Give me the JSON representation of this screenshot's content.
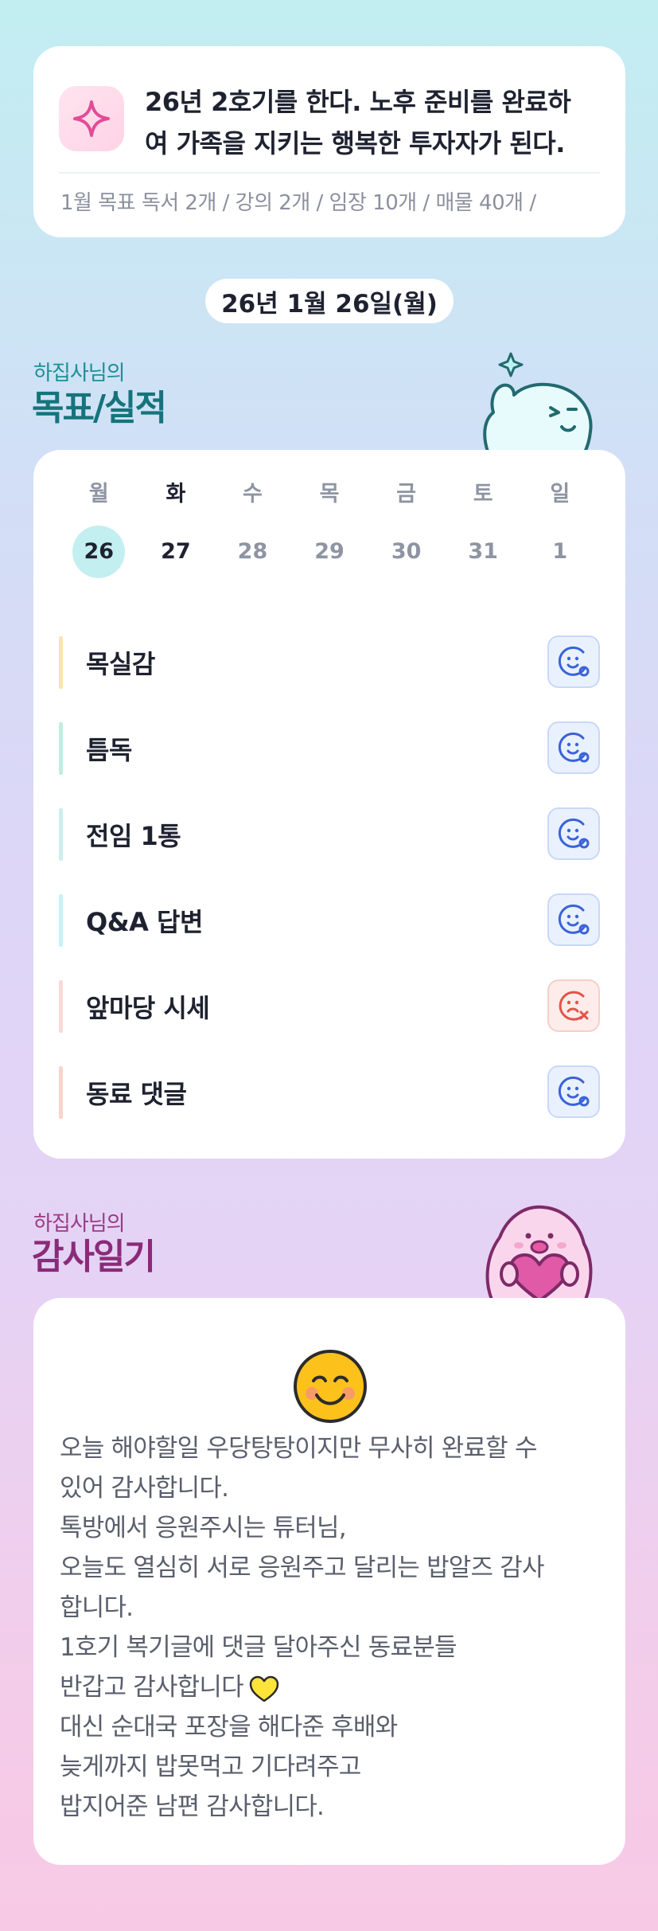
{
  "goal": {
    "icon": "sparkle-icon",
    "line1": "26년 2호기를 한다. 노후 준비를 완료하",
    "line2": "여 가족을 지키는 행복한 투자자가 된다.",
    "monthly": "1월 목표  독서 2개 / 강의 2개 / 임장 10개 / 매물 40개 /"
  },
  "date_label": "26년 1월 26일(월)",
  "record_section": {
    "subtitle": "하집사님의",
    "title": "목표/실적"
  },
  "calendar": {
    "days": [
      "월",
      "화",
      "수",
      "목",
      "금",
      "토",
      "일"
    ],
    "dates": [
      "26",
      "27",
      "28",
      "29",
      "30",
      "31",
      "1"
    ],
    "selected_index": 0
  },
  "tasks": [
    {
      "label": "목실감",
      "status": "done",
      "bar_color": "#fbe3b5"
    },
    {
      "label": "틈독",
      "status": "done",
      "bar_color": "#bfeee0"
    },
    {
      "label": "전임 1통",
      "status": "done",
      "bar_color": "#cdeeee"
    },
    {
      "label": "Q&A 답변",
      "status": "done",
      "bar_color": "#c8f1f5"
    },
    {
      "label": "앞마당 시세",
      "status": "fail",
      "bar_color": "#fddad7"
    },
    {
      "label": "동료 댓글",
      "status": "done",
      "bar_color": "#f9d3cc"
    }
  ],
  "diary_section": {
    "subtitle": "하집사님의",
    "title": "감사일기"
  },
  "diary": {
    "emoji": "smiling-face-icon",
    "lines": [
      "오늘 해야할일 우당탕탕이지만 무사히 완료할 수",
      "있어 감사합니다.",
      "톡방에서 응원주시는 튜터님,",
      "오늘도 열심히 서로 응원주고 달리는 밥알즈 감사",
      "합니다.",
      "1호기 복기글에 댓글 달아주신 동료분들",
      "반갑고 감사합니다",
      "대신 순대국 포장을 해다준 후배와",
      "늦게까지 밥못먹고 기다려주고",
      "밥지어준 남편 감사합니다."
    ],
    "heart_line_index": 6
  },
  "colors": {
    "accent_teal": "#1d8f95",
    "accent_purple": "#9a3b86",
    "ok_icon": "#3a63d8",
    "fail_icon": "#e0554a"
  }
}
